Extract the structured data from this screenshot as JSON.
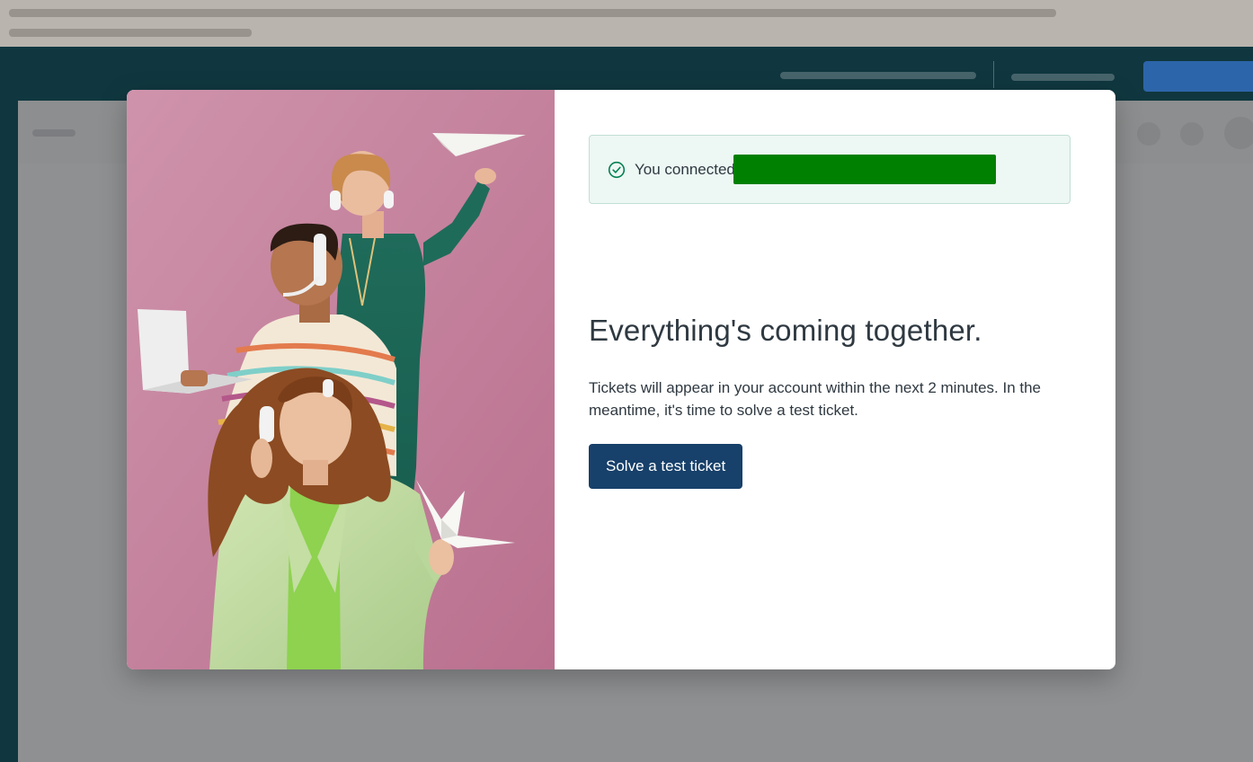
{
  "modal": {
    "toast": {
      "message": "You connected",
      "icon": "check-circle-icon"
    },
    "headline": "Everything's coming together.",
    "description": "Tickets will appear in your account within the next 2 minutes. In the meantime, it's time to solve a test ticket.",
    "cta_label": "Solve a test ticket",
    "hero_image": "photo-three-support-agents-with-headsets"
  },
  "colors": {
    "hero_background": "#c9829f",
    "toast_background": "#edf7f3",
    "toast_border": "#c2dfd6",
    "success_icon": "#038153",
    "redaction": "#008000",
    "primary_button": "#17406a",
    "text": "#2f3941",
    "app_header": "#0c3b45"
  }
}
